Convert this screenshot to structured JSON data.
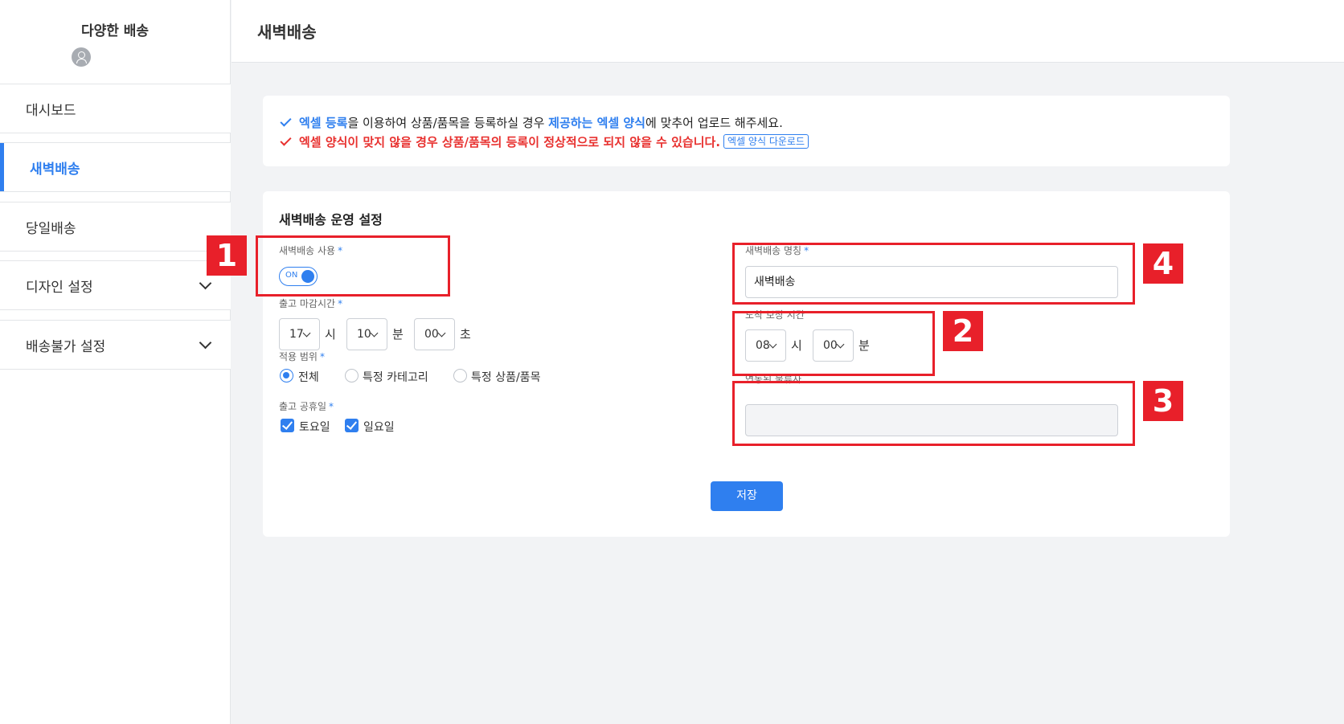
{
  "sidebar": {
    "brand_title": "다양한 배송",
    "items": [
      {
        "label": "대시보드"
      },
      {
        "label": "새벽배송"
      },
      {
        "label": "당일배송"
      },
      {
        "label": "디자인 설정"
      },
      {
        "label": "배송불가 설정"
      }
    ]
  },
  "header": {
    "title": "새벽배송"
  },
  "notice": {
    "line1": {
      "p1": "엑셀 등록",
      "p2": "을 이용하여 상품/품목을 등록하실 경우 ",
      "p3": "제공하는 엑셀 양식",
      "p4": "에 맞추어 업로드 해주세요."
    },
    "line2": "엑셀 양식이 맞지 않을 경우 상품/품목의 등록이 정상적으로 되지 않을 수 있습니다.",
    "download_label": "엑셀 양식 다운로드"
  },
  "settings": {
    "title": "새벽배송 운영 설정",
    "use_label": "새벽배송 사용",
    "use_toggle": "ON",
    "cutoff_label": "출고 마감시간",
    "cutoff": {
      "hour": "17",
      "hour_unit": "시",
      "minute": "10",
      "minute_unit": "분",
      "second": "00",
      "second_unit": "초"
    },
    "scope_label": "적용 범위",
    "scope_options": [
      "전체",
      "특정 카테고리",
      "특정 상품/품목"
    ],
    "scope_selected": "전체",
    "holiday_label": "출고 공휴일",
    "holidays": [
      {
        "label": "토요일",
        "checked": true
      },
      {
        "label": "일요일",
        "checked": true
      }
    ],
    "name_label": "새벽배송 명칭",
    "name_value": "새벽배송",
    "arrival_label": "도착 보장 시간",
    "arrival": {
      "hour": "08",
      "hour_unit": "시",
      "minute": "00",
      "minute_unit": "분"
    },
    "carrier_label": "연동된 물류사",
    "carrier_value": "",
    "required_mark": "*",
    "save_label": "저장"
  },
  "annotations": [
    "1",
    "2",
    "3",
    "4"
  ],
  "colors": {
    "accent": "#2f7fef",
    "warning": "#e8312f",
    "annotation": "#e8202a"
  }
}
